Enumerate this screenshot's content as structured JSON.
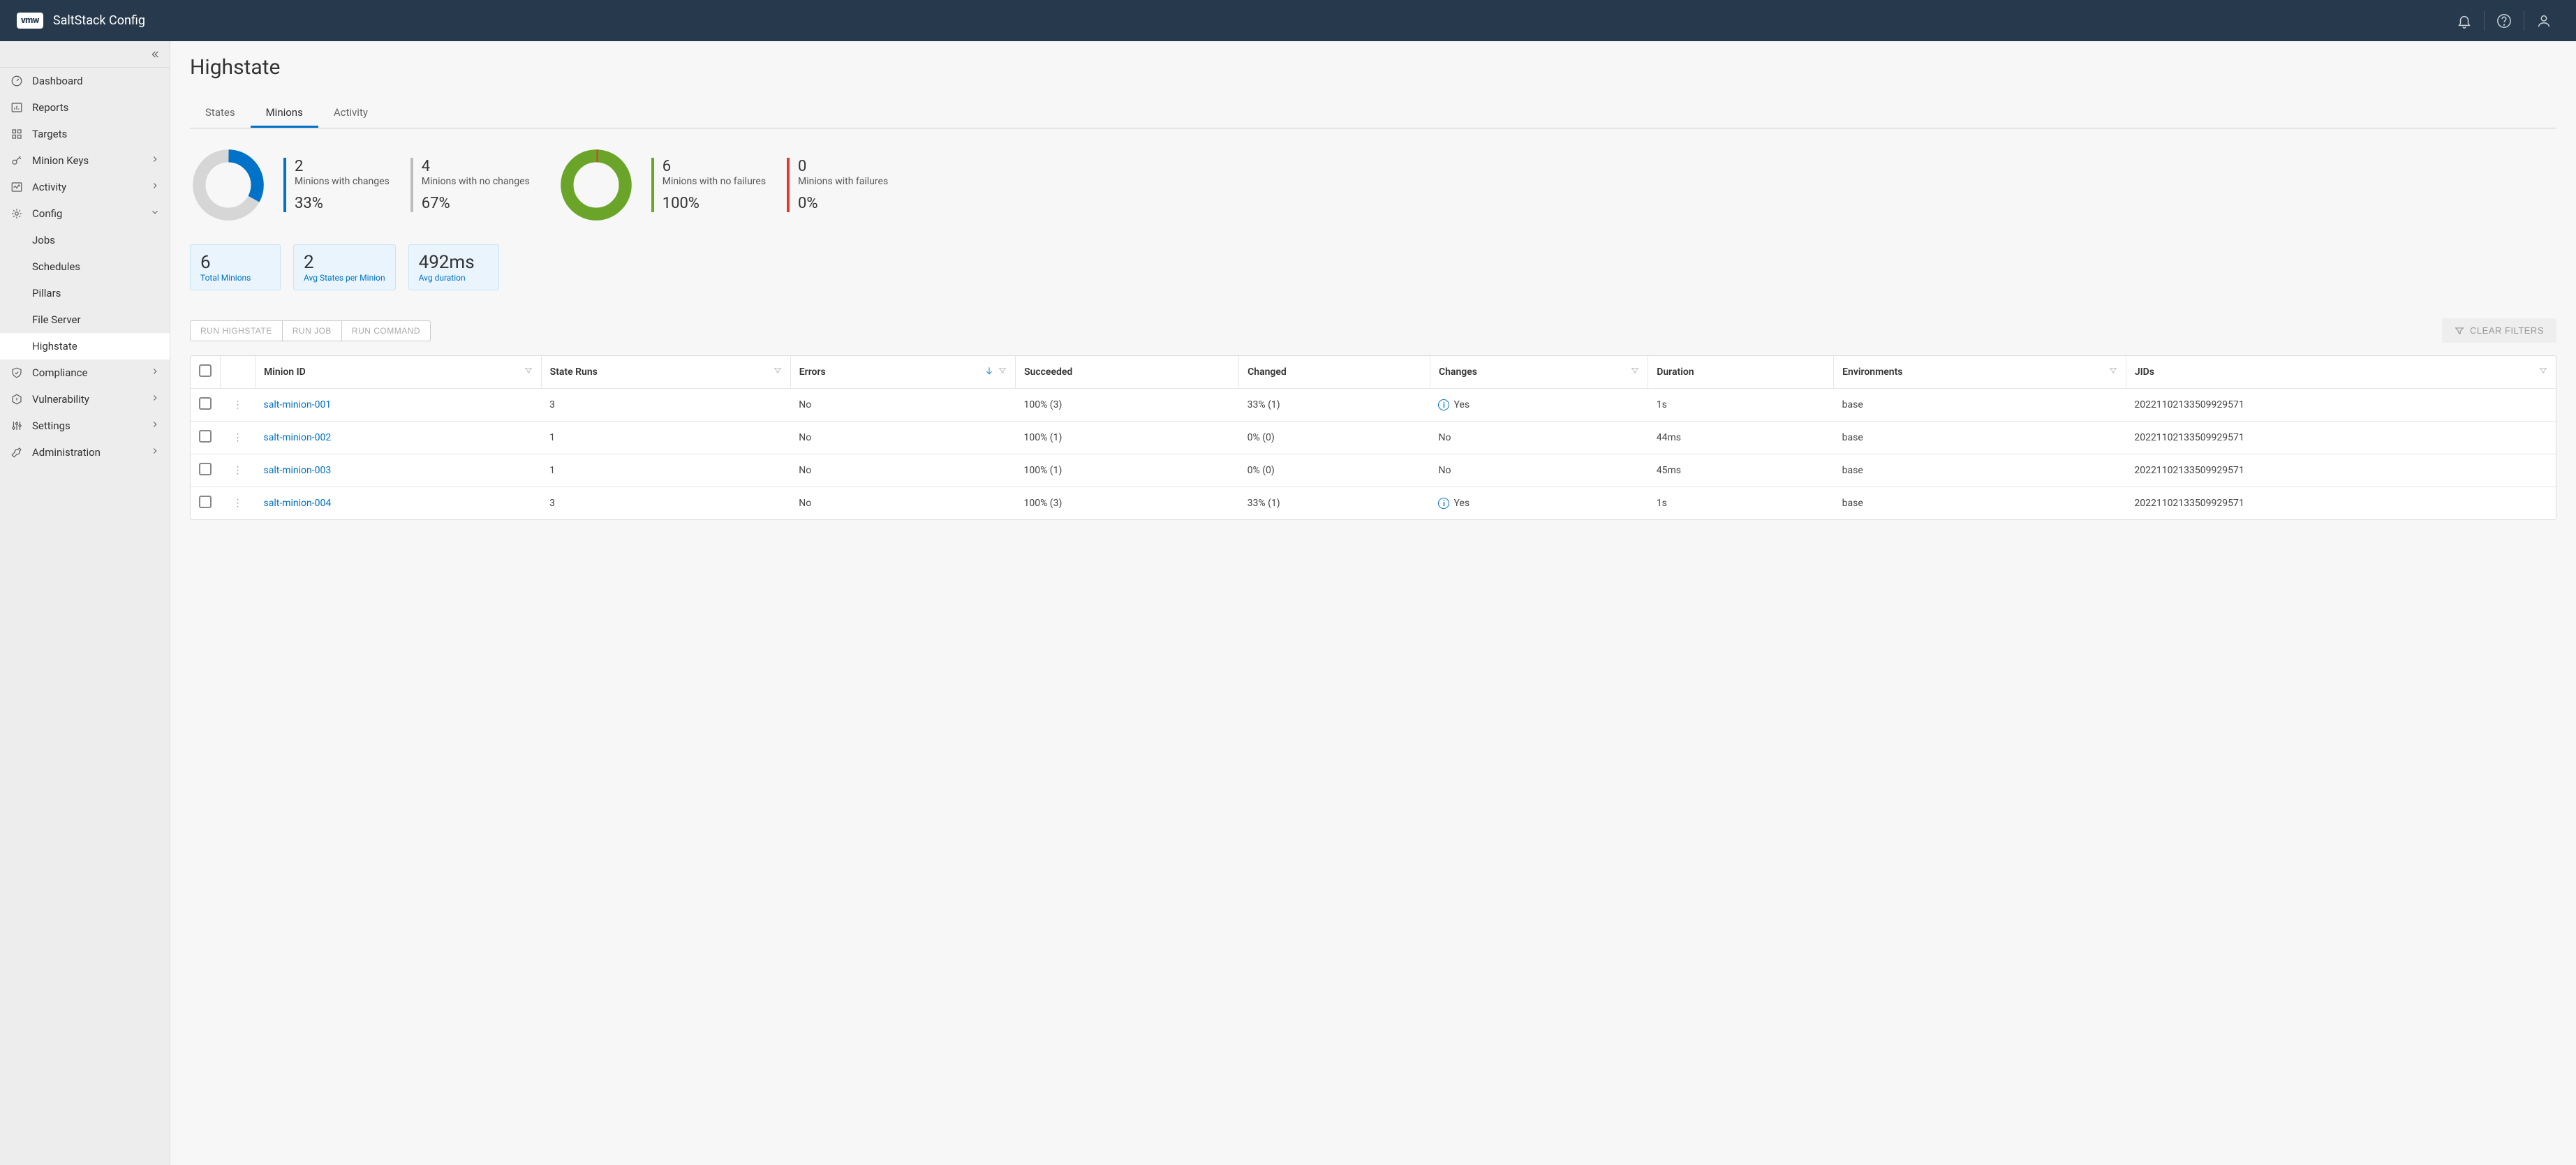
{
  "header": {
    "logo": "vmw",
    "title": "SaltStack Config"
  },
  "sidebar": {
    "items": [
      {
        "label": "Dashboard",
        "icon": "gauge",
        "expandable": false
      },
      {
        "label": "Reports",
        "icon": "barchart",
        "expandable": false
      },
      {
        "label": "Targets",
        "icon": "grid",
        "expandable": false
      },
      {
        "label": "Minion Keys",
        "icon": "key",
        "expandable": true
      },
      {
        "label": "Activity",
        "icon": "activity",
        "expandable": true
      },
      {
        "label": "Config",
        "icon": "gear",
        "expandable": true,
        "expanded": true,
        "children": [
          {
            "label": "Jobs"
          },
          {
            "label": "Schedules"
          },
          {
            "label": "Pillars"
          },
          {
            "label": "File Server"
          },
          {
            "label": "Highstate",
            "active": true
          }
        ]
      },
      {
        "label": "Compliance",
        "icon": "shield",
        "expandable": true
      },
      {
        "label": "Vulnerability",
        "icon": "hexagon",
        "expandable": true
      },
      {
        "label": "Settings",
        "icon": "sliders",
        "expandable": true
      },
      {
        "label": "Administration",
        "icon": "wrench",
        "expandable": true
      }
    ]
  },
  "page": {
    "title": "Highstate",
    "tabs": [
      {
        "label": "States",
        "active": false
      },
      {
        "label": "Minions",
        "active": true
      },
      {
        "label": "Activity",
        "active": false
      }
    ],
    "summary": {
      "changes": [
        {
          "num": "2",
          "desc": "Minions with changes",
          "pct": "33%",
          "color": "#0072c7"
        },
        {
          "num": "4",
          "desc": "Minions with no changes",
          "pct": "67%",
          "color": "#bdbdbd"
        }
      ],
      "failures": [
        {
          "num": "6",
          "desc": "Minions with no failures",
          "pct": "100%",
          "color": "#6aa52a"
        },
        {
          "num": "0",
          "desc": "Minions with failures",
          "pct": "0%",
          "color": "#e23b2e"
        }
      ]
    },
    "cards": [
      {
        "big": "6",
        "label": "Total Minions"
      },
      {
        "big": "2",
        "label": "Avg States per Minion"
      },
      {
        "big": "492ms",
        "label": "Avg duration"
      }
    ],
    "actions": {
      "run_highstate": "RUN HIGHSTATE",
      "run_job": "RUN JOB",
      "run_command": "RUN COMMAND",
      "clear_filters": "CLEAR FILTERS"
    },
    "table": {
      "columns": [
        "Minion ID",
        "State Runs",
        "Errors",
        "Succeeded",
        "Changed",
        "Changes",
        "Duration",
        "Environments",
        "JIDs"
      ],
      "rows": [
        {
          "minion_id": "salt-minion-001",
          "state_runs": "3",
          "errors": "No",
          "succeeded": "100% (3)",
          "changed": "33% (1)",
          "changes": "Yes",
          "changes_info": true,
          "duration": "1s",
          "environments": "base",
          "jids": "20221102133509929571"
        },
        {
          "minion_id": "salt-minion-002",
          "state_runs": "1",
          "errors": "No",
          "succeeded": "100% (1)",
          "changed": "0% (0)",
          "changes": "No",
          "changes_info": false,
          "duration": "44ms",
          "environments": "base",
          "jids": "20221102133509929571"
        },
        {
          "minion_id": "salt-minion-003",
          "state_runs": "1",
          "errors": "No",
          "succeeded": "100% (1)",
          "changed": "0% (0)",
          "changes": "No",
          "changes_info": false,
          "duration": "45ms",
          "environments": "base",
          "jids": "20221102133509929571"
        },
        {
          "minion_id": "salt-minion-004",
          "state_runs": "3",
          "errors": "No",
          "succeeded": "100% (3)",
          "changed": "33% (1)",
          "changes": "Yes",
          "changes_info": true,
          "duration": "1s",
          "environments": "base",
          "jids": "20221102133509929571"
        }
      ]
    }
  },
  "chart_data": [
    {
      "type": "pie",
      "title": "Minions by change status",
      "series": [
        {
          "name": "Minions with changes",
          "value": 2,
          "pct": 33,
          "color": "#0072c7"
        },
        {
          "name": "Minions with no changes",
          "value": 4,
          "pct": 67,
          "color": "#bdbdbd"
        }
      ]
    },
    {
      "type": "pie",
      "title": "Minions by failure status",
      "series": [
        {
          "name": "Minions with no failures",
          "value": 6,
          "pct": 100,
          "color": "#6aa52a"
        },
        {
          "name": "Minions with failures",
          "value": 0,
          "pct": 0,
          "color": "#e23b2e"
        }
      ]
    }
  ]
}
